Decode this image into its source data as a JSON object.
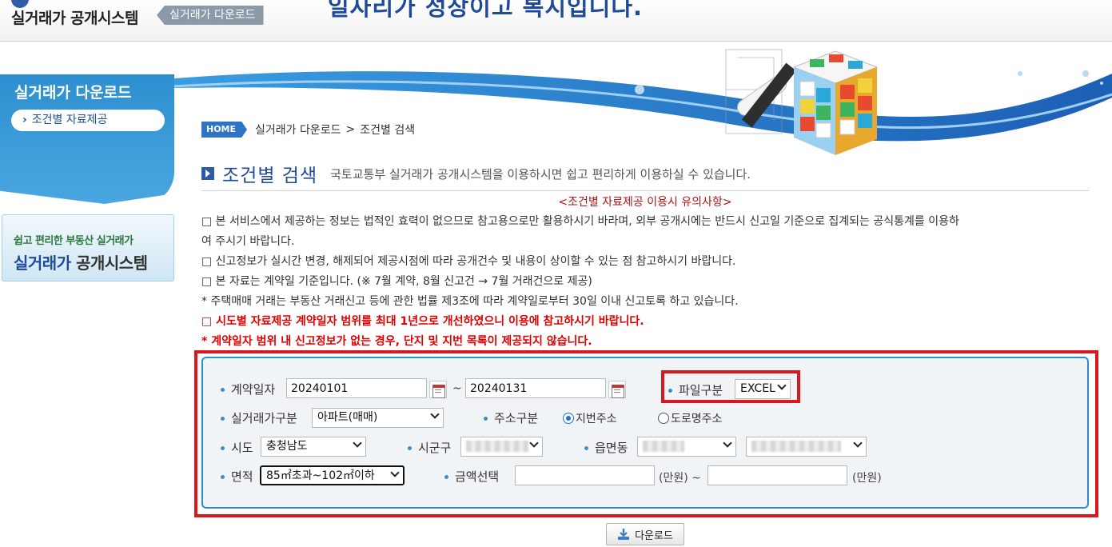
{
  "header": {
    "logo_text": "실거래가 공개시스템",
    "logo_sub": "실거래가 다운로드",
    "slogan": "일자리가 성장이고 복지입니다."
  },
  "sidebar": {
    "title": "실거래가 다운로드",
    "items": [
      {
        "label": "조건별 자료제공"
      }
    ],
    "promo": {
      "small": "쉽고 편리한 부동산 실거래가",
      "big_blue": "실거래가",
      "big_dark": "공개시스템"
    }
  },
  "breadcrumb": {
    "home": "HOME",
    "items": [
      "실거래가 다운로드",
      "조건별 검색"
    ],
    "separator": ">"
  },
  "page": {
    "title": "조건별 검색",
    "description": "국토교통부 실거래가 공개시스템을 이용하시면 쉽고 편리하게 이용하실 수 있습니다."
  },
  "notices": {
    "heading": "<조건별 자료제공 이용시 유의사항>",
    "lines": [
      "□ 본 서비스에서 제공하는 정보는 법적인 효력이 없으므로 참고용으로만 활용하시기 바라며, 외부 공개시에는 반드시 신고일 기준으로 집계되는 공식통계를 이용하",
      "여 주시기 바랍니다.",
      "□ 신고정보가 실시간 변경, 해제되어 제공시점에 따라 공개건수 및 내용이 상이할 수 있는 점 참고하시기 바랍니다.",
      "□ 본 자료는 계약일 기준입니다. (※ 7월 계약, 8월 신고건 → 7월 거래건으로 제공)",
      "* 주택매매 거래는 부동산 거래신고 등에 관한 법률 제3조에 따라 계약일로부터 30일 이내 신고토록 하고 있습니다.",
      "□ 시도별 자료제공 계약일자 범위를 최대 1년으로 개선하였으니 이용에 참고하시기 바랍니다.",
      "* 계약일자 범위 내 신고정보가 없는 경우, 단지 및 지번 목록이 제공되지 않습니다."
    ]
  },
  "form": {
    "contract_date_label": "계약일자",
    "date_from": "20240101",
    "date_to": "20240131",
    "tilde": "~",
    "file_type_label": "파일구분",
    "file_type_value": "EXCEL",
    "trade_type_label": "실거래가구분",
    "trade_type_value": "아파트(매매)",
    "address_type_label": "주소구분",
    "address_options": [
      "지번주소",
      "도로명주소"
    ],
    "address_selected": "지번주소",
    "sido_label": "시도",
    "sido_value": "충청남도",
    "sigungu_label": "시군구",
    "eupmyeondong_label": "읍면동",
    "area_label": "면적",
    "area_value": "85㎡초과~102㎡이하",
    "amount_label": "금액선택",
    "amount_from": "",
    "amount_to": "",
    "unit_from": "(만원) ~",
    "unit_to": "(만원)"
  },
  "download_button": "다운로드",
  "colors": {
    "accent_blue": "#1e4a9c",
    "highlight_red": "#d8181f",
    "form_border": "#2d8fc4"
  }
}
